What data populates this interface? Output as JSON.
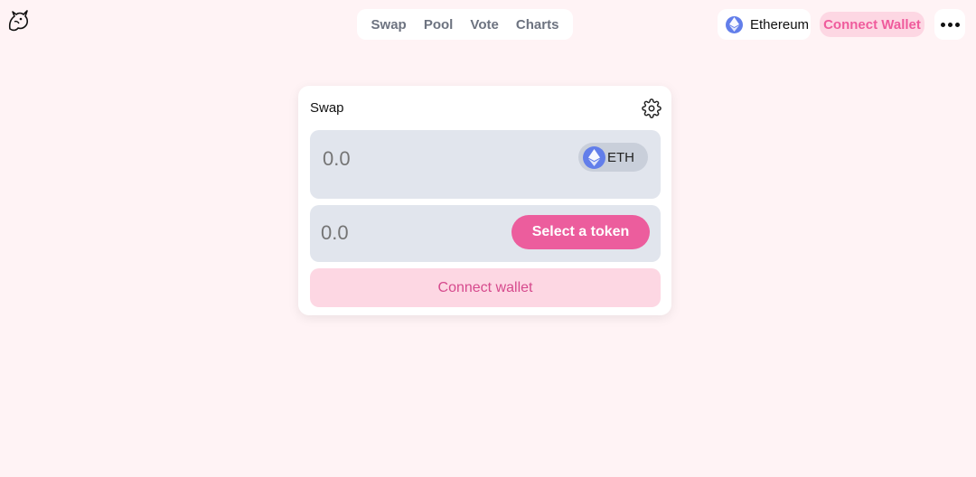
{
  "nav": {
    "items": [
      {
        "label": "Swap"
      },
      {
        "label": "Pool"
      },
      {
        "label": "Vote"
      },
      {
        "label": "Charts"
      }
    ]
  },
  "header": {
    "network_label": "Ethereum",
    "connect_label": "Connect Wallet",
    "more_icon": "ellipsis-icon",
    "logo_icon": "unicorn-logo"
  },
  "swap_card": {
    "title": "Swap",
    "settings_icon": "gear-icon",
    "input_from": {
      "placeholder": "0.0",
      "token_label": "ETH",
      "token_icon": "ethereum-icon"
    },
    "input_to": {
      "placeholder": "0.0",
      "select_label": "Select a token"
    },
    "connect_wallet_label": "Connect wallet"
  },
  "colors": {
    "background": "#fff3f5",
    "accent_pink": "#ec5d9d",
    "soft_pink": "#fdd7e3",
    "input_gray": "#e1e5ed",
    "eth_blue": "#627eea"
  }
}
